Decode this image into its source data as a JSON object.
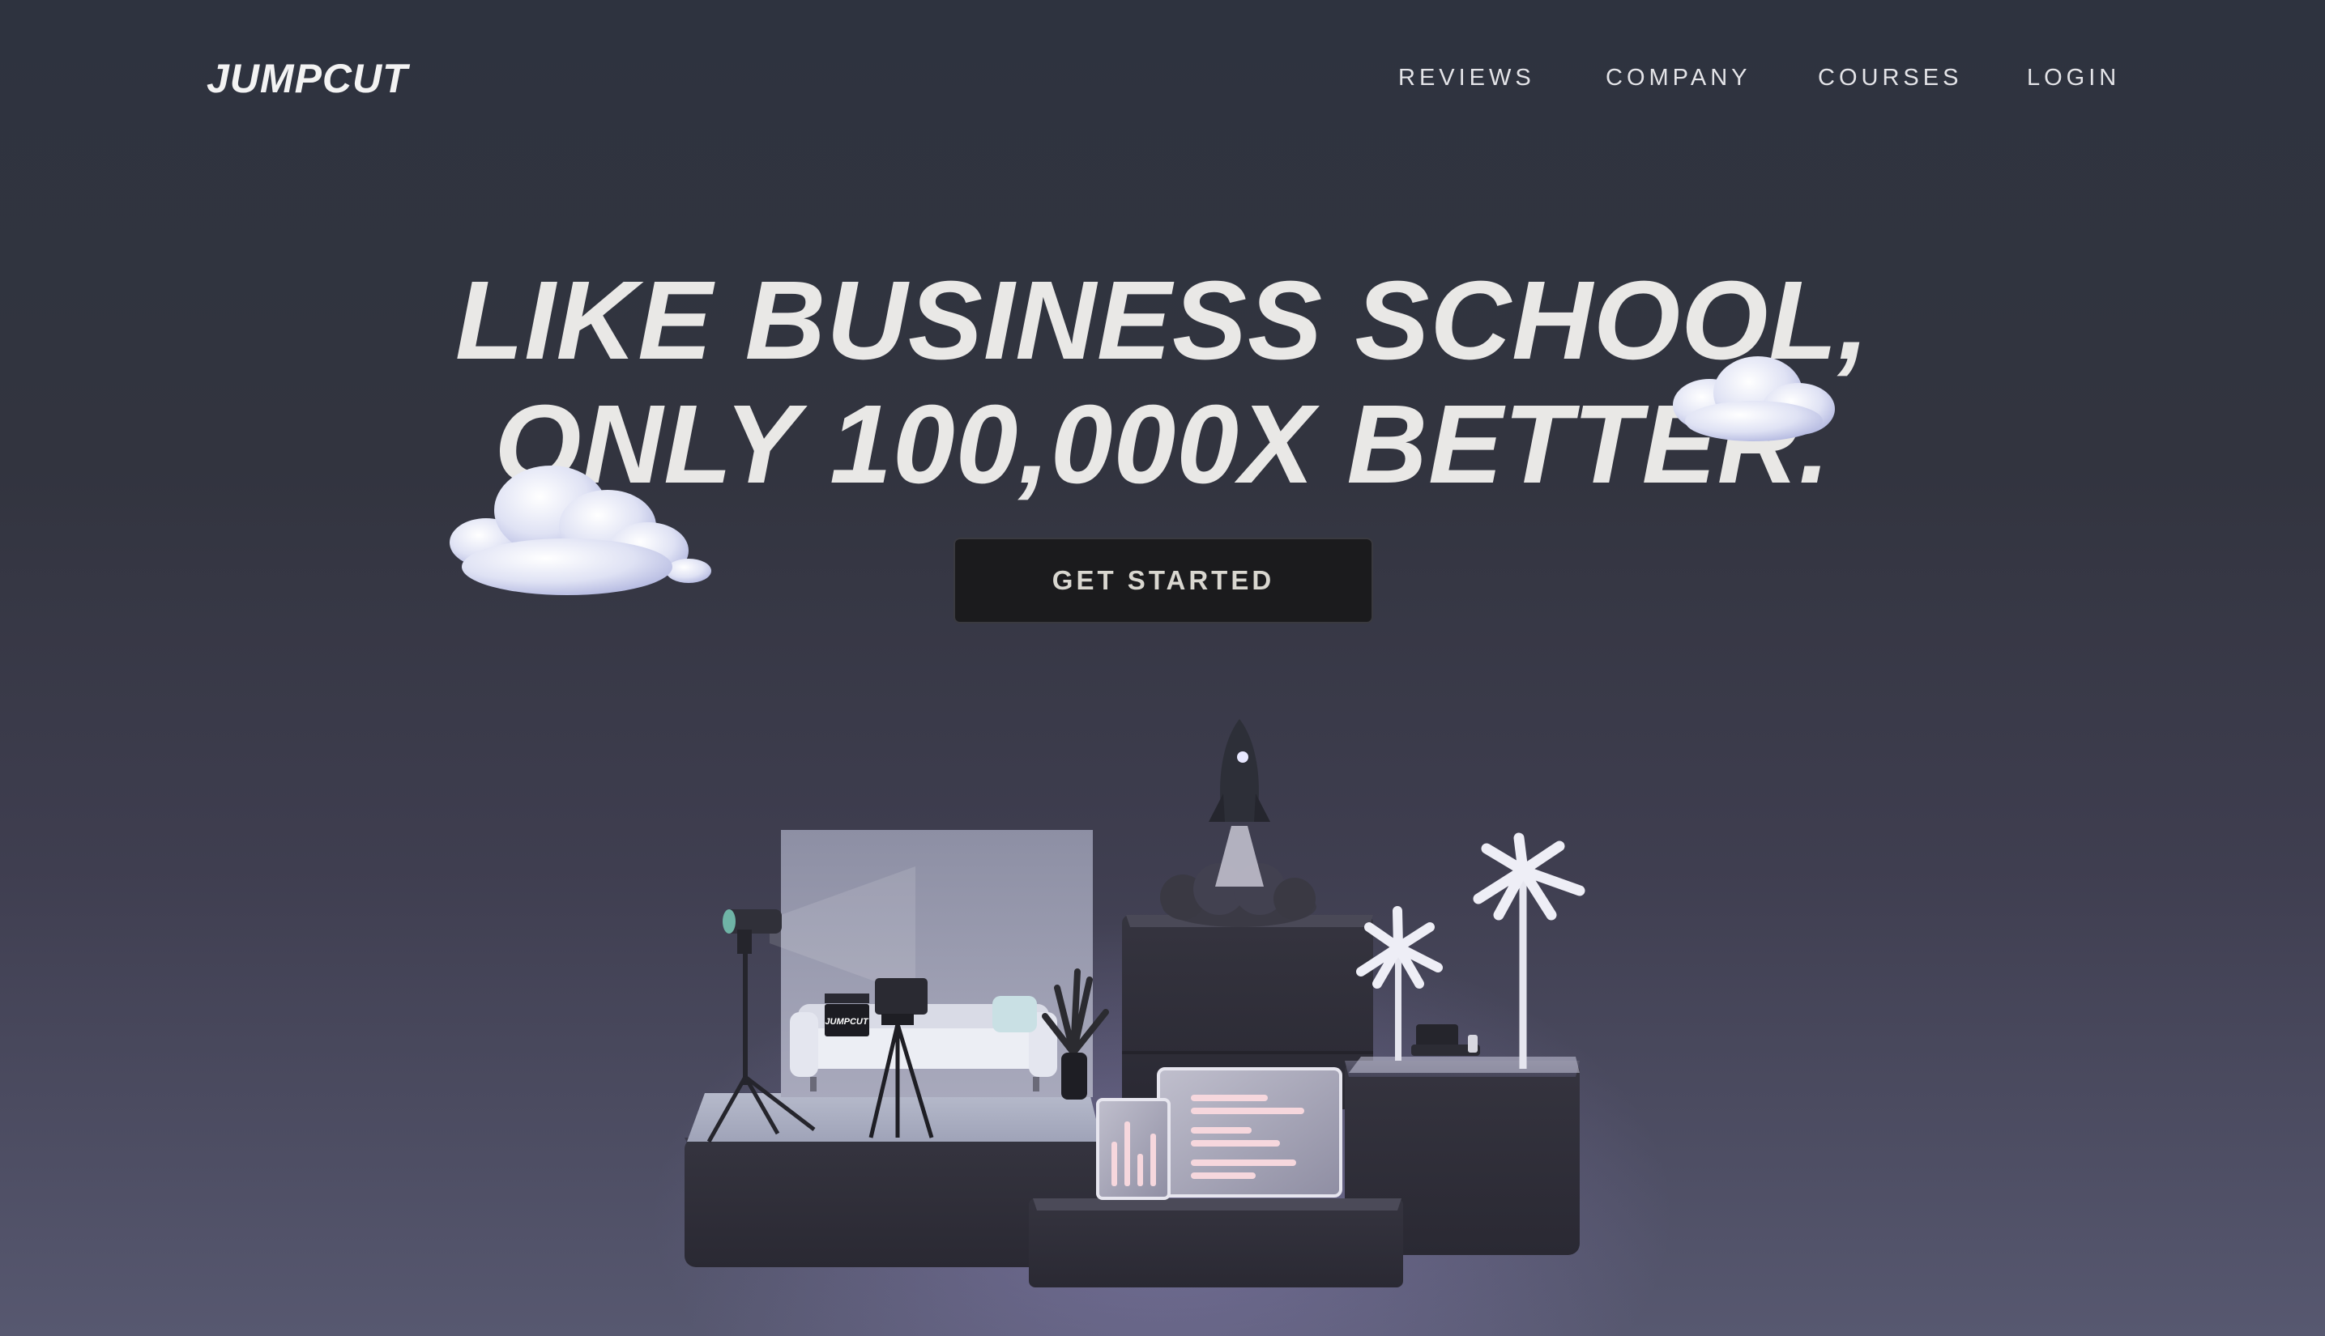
{
  "brand": {
    "logo": "JUMPCUT"
  },
  "nav": {
    "items": [
      {
        "label": "REVIEWS"
      },
      {
        "label": "COMPANY"
      },
      {
        "label": "COURSES"
      },
      {
        "label": "LOGIN"
      }
    ]
  },
  "hero": {
    "headline_line1": "LIKE BUSINESS SCHOOL,",
    "headline_line2": "ONLY 100,000X BETTER.",
    "cta_label": "GET STARTED"
  },
  "illustration": {
    "clapperboard_text": "JUMPCUT",
    "icons": [
      "cloud-icon",
      "rocket-icon",
      "camera-icon",
      "sofa-icon",
      "palm-tree-icon",
      "bar-chart-icon",
      "text-lines-icon"
    ]
  },
  "colors": {
    "background": "#30343f",
    "text": "#e9e8e6",
    "button": "#1b1b1d"
  }
}
